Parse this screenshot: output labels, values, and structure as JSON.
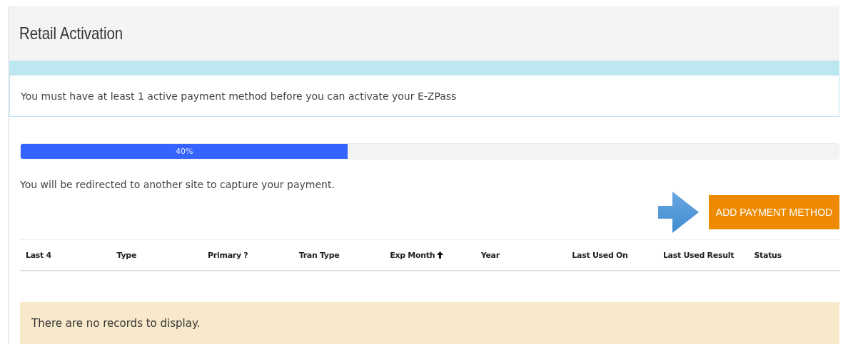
{
  "header": {
    "title": "Retail Activation"
  },
  "alert": {
    "text": "You must have at least 1 active payment method before you can activate your E-ZPass"
  },
  "progress": {
    "level": 0.4,
    "label": "40%"
  },
  "redirect_note": "You will be redirected to another site to capture your payment.",
  "add_button": {
    "label": "ADD PAYMENT METHOD"
  },
  "table": {
    "columns": [
      {
        "label": "Last 4",
        "sorted": false
      },
      {
        "label": "Type",
        "sorted": false
      },
      {
        "label": "Primary ?",
        "sorted": false
      },
      {
        "label": "Tran Type",
        "sorted": false
      },
      {
        "label": "Exp Month",
        "sorted": true
      },
      {
        "label": "Year",
        "sorted": false
      },
      {
        "label": "Last Used On",
        "sorted": false
      },
      {
        "label": "Last Used Result",
        "sorted": false
      },
      {
        "label": "Status",
        "sorted": false
      }
    ],
    "empty_message": "There are no records to display."
  }
}
